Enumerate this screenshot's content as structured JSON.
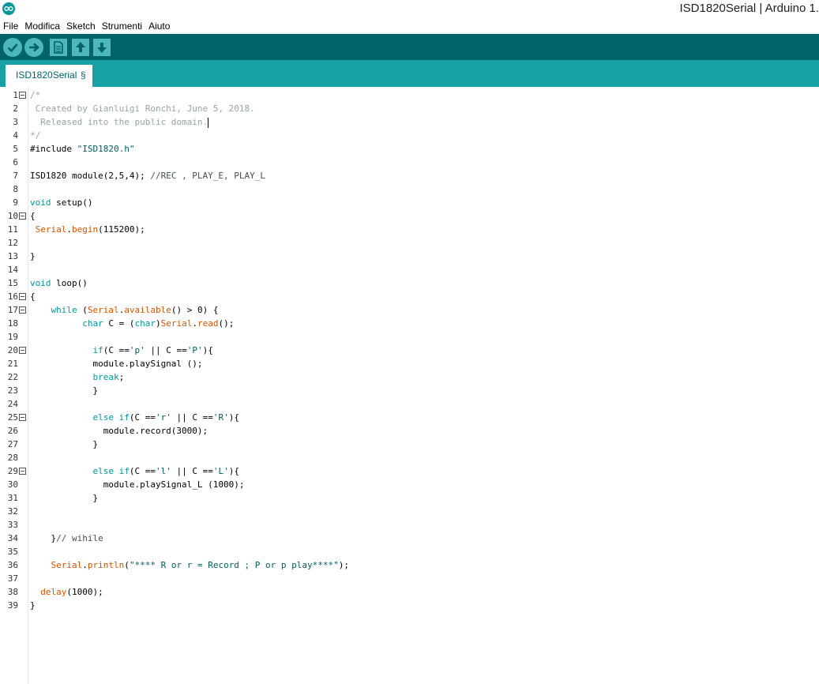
{
  "window": {
    "title": "ISD1820Serial | Arduino 1."
  },
  "menu": {
    "items": [
      "File",
      "Modifica",
      "Sketch",
      "Strumenti",
      "Aiuto"
    ]
  },
  "toolbar": {
    "buttons": [
      "verify-icon",
      "upload-icon",
      "new-icon",
      "open-icon",
      "save-icon"
    ],
    "colors": {
      "toolbar_bg": "#006468",
      "tabbar_bg": "#17a1a5",
      "button_bg": "#4db7bb"
    }
  },
  "tab": {
    "label": "ISD1820Serial",
    "modified_marker": "§"
  },
  "editor": {
    "lines": [
      "/*",
      " Created by Gianluigi Ronchi, June 5, 2018.",
      "  Released into the public domain.",
      "*/",
      "#include \"ISD1820.h\"",
      "",
      "ISD1820 module(2,5,4); //REC , PLAY_E, PLAY_L",
      "",
      "void setup()",
      "{",
      " Serial.begin(115200);",
      "",
      "}",
      "",
      "void loop()",
      "{",
      "    while (Serial.available() > 0) {",
      "          char C = (char)Serial.read();",
      "",
      "            if(C =='p' || C =='P'){",
      "            module.playSignal ();",
      "            break;",
      "            }",
      "",
      "            else if(C =='r' || C =='R'){",
      "              module.record(3000);",
      "            }",
      "",
      "            else if(C =='l' || C =='L'){",
      "              module.playSignal_L (1000);",
      "            }",
      "",
      "",
      "    }// wihile",
      "",
      "    Serial.println(\"**** R or r = Record ; P or p play****\");",
      "",
      "  delay(1000);",
      "}"
    ],
    "fold_markers_on_lines": [
      1,
      10,
      16,
      17,
      20,
      25,
      29
    ]
  }
}
